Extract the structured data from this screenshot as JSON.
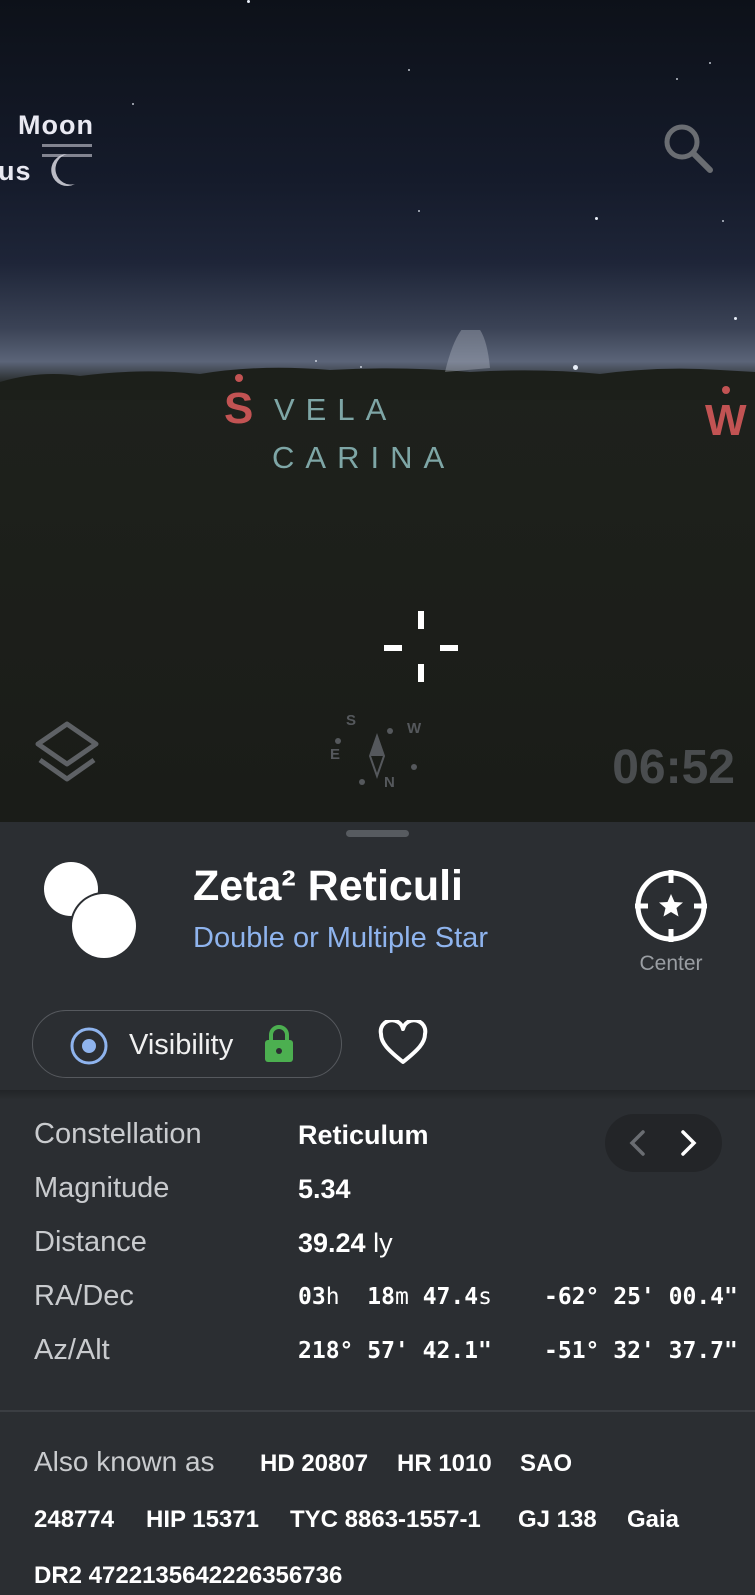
{
  "sky": {
    "planet_labels": {
      "moon": "Moon",
      "venus_partial": "us"
    },
    "cardinals": {
      "south": "S",
      "west": "W"
    },
    "constellations": {
      "vela": "VELA",
      "carina": "CARINA"
    },
    "compass": {
      "s": "S",
      "w": "W",
      "e": "E",
      "n": "N"
    },
    "time": "06:52"
  },
  "object": {
    "name": "Zeta² Reticuli",
    "type": "Double or Multiple Star",
    "center_label": "Center",
    "visibility_label": "Visibility"
  },
  "info": {
    "constellation": {
      "label": "Constellation",
      "value": "Reticulum"
    },
    "magnitude": {
      "label": "Magnitude",
      "value": "5.34"
    },
    "distance": {
      "label": "Distance",
      "value": "39.24",
      "unit": "ly"
    },
    "radec": {
      "label": "RA/Dec",
      "ra_h": "03",
      "ra_h_u": "h",
      "ra_m": "18",
      "ra_m_u": "m",
      "ra_s": "47.4",
      "ra_s_u": "s",
      "dec": "-62° 25' 00.4\""
    },
    "azalt": {
      "label": "Az/Alt",
      "az": "218° 57' 42.1\"",
      "alt": "-51° 32' 37.7\""
    }
  },
  "aka": {
    "label": "Also known as",
    "names": [
      "HD 20807",
      "HR 1010",
      "SAO",
      "248774",
      "HIP 15371",
      "TYC 8863-1557-1",
      "GJ 138",
      "Gaia",
      "DR2 4722135642226356736"
    ]
  },
  "colors": {
    "accent": "#8fb4ee",
    "cardinal": "#c25353",
    "constellation": "#7ea6a6",
    "lock": "#4caf50"
  }
}
